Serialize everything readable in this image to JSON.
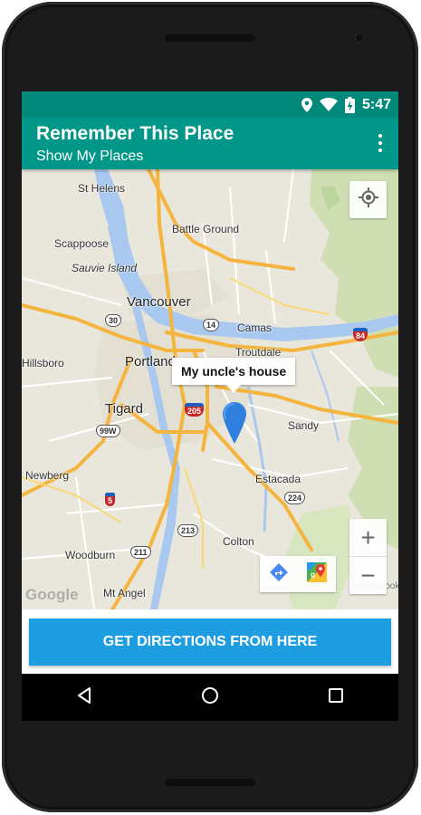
{
  "status_bar": {
    "time": "5:47"
  },
  "app_bar": {
    "title": "Remember This Place",
    "subtitle": "Show My Places"
  },
  "map": {
    "place_labels": {
      "st_helens": "St Helens",
      "battle_ground": "Battle Ground",
      "scappoose": "Scappoose",
      "sauvie_island": "Sauvie Island",
      "vancouver": "Vancouver",
      "camas": "Camas",
      "troutdale": "Troutdale",
      "hillsboro": "Hillsboro",
      "portland": "Portland",
      "tigard": "Tigard",
      "sandy": "Sandy",
      "newberg": "Newberg",
      "estacada": "Estacada",
      "colton": "Colton",
      "woodburn": "Woodburn",
      "mt_angel": "Mt Angel",
      "ripplebrook": "Ripplebrook"
    },
    "route_shields": {
      "r30": "30",
      "r14": "14",
      "r84": "84",
      "r205": "205",
      "r99w": "99W",
      "r5": "5",
      "r224": "224",
      "r213": "213",
      "r211": "211"
    },
    "google_logo": "Google",
    "marker_label": "My uncle's house"
  },
  "controls": {
    "zoom_in": "+",
    "zoom_out": "−"
  },
  "cta": {
    "label": "GET DIRECTIONS FROM HERE"
  },
  "colors": {
    "primary": "#009688",
    "primary_dark": "#00897b",
    "accent": "#1e9ee0"
  }
}
